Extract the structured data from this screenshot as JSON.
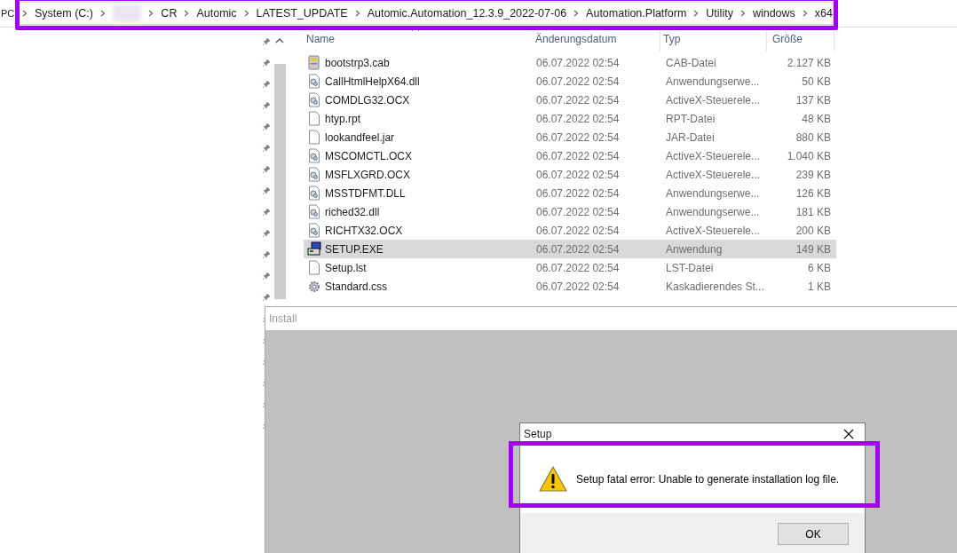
{
  "address_bar": {
    "root": "PC",
    "segments": [
      {
        "kind": "text",
        "label": "System (C:)"
      },
      {
        "kind": "redacted"
      },
      {
        "kind": "text",
        "label": "CR"
      },
      {
        "kind": "text",
        "label": "Automic"
      },
      {
        "kind": "text",
        "label": "LATEST_UPDATE"
      },
      {
        "kind": "text",
        "label": "Automic.Automation_12.3.9_2022-07-06"
      },
      {
        "kind": "text",
        "label": "Automation.Platform"
      },
      {
        "kind": "text",
        "label": "Utility"
      },
      {
        "kind": "text",
        "label": "windows"
      },
      {
        "kind": "text",
        "label": "x64"
      }
    ]
  },
  "file_list": {
    "columns": [
      "Name",
      "Änderungsdatum",
      "Typ",
      "Größe"
    ],
    "rows": [
      {
        "kind": "cab",
        "name": "bootstrp3.cab",
        "date": "06.07.2022 02:54",
        "type": "CAB-Datei",
        "size": "2.127 KB",
        "selected": false
      },
      {
        "kind": "library",
        "name": "CallHtmlHelpX64.dll",
        "date": "06.07.2022 02:54",
        "type": "Anwendungserwe...",
        "size": "50 KB",
        "selected": false
      },
      {
        "kind": "library",
        "name": "COMDLG32.OCX",
        "date": "06.07.2022 02:54",
        "type": "ActiveX-Steuerele...",
        "size": "137 KB",
        "selected": false
      },
      {
        "kind": "file",
        "name": "htyp.rpt",
        "date": "06.07.2022 02:54",
        "type": "RPT-Datei",
        "size": "48 KB",
        "selected": false
      },
      {
        "kind": "file",
        "name": "lookandfeel.jar",
        "date": "06.07.2022 02:54",
        "type": "JAR-Datei",
        "size": "880 KB",
        "selected": false
      },
      {
        "kind": "library",
        "name": "MSCOMCTL.OCX",
        "date": "06.07.2022 02:54",
        "type": "ActiveX-Steuerele...",
        "size": "1.040 KB",
        "selected": false
      },
      {
        "kind": "library",
        "name": "MSFLXGRD.OCX",
        "date": "06.07.2022 02:54",
        "type": "ActiveX-Steuerele...",
        "size": "239 KB",
        "selected": false
      },
      {
        "kind": "library",
        "name": "MSSTDFMT.DLL",
        "date": "06.07.2022 02:54",
        "type": "Anwendungserwe...",
        "size": "126 KB",
        "selected": false
      },
      {
        "kind": "library",
        "name": "riched32.dll",
        "date": "06.07.2022 02:54",
        "type": "Anwendungserwe...",
        "size": "181 KB",
        "selected": false
      },
      {
        "kind": "library",
        "name": "RICHTX32.OCX",
        "date": "06.07.2022 02:54",
        "type": "ActiveX-Steuerele...",
        "size": "200 KB",
        "selected": false
      },
      {
        "kind": "setup",
        "name": "SETUP.EXE",
        "date": "06.07.2022 02:54",
        "type": "Anwendung",
        "size": "149 KB",
        "selected": true
      },
      {
        "kind": "file",
        "name": "Setup.lst",
        "date": "06.07.2022 02:54",
        "type": "LST-Datei",
        "size": "6 KB",
        "selected": false
      },
      {
        "kind": "settings",
        "name": "Standard.css",
        "date": "06.07.2022 02:54",
        "type": "Kaskadierendes St...",
        "size": "1 KB",
        "selected": false
      }
    ]
  },
  "install_window": {
    "title": "Install"
  },
  "setup_dialog": {
    "title": "Setup",
    "message": "Setup fatal error: Unable to generate installation log file.",
    "button": "OK"
  }
}
